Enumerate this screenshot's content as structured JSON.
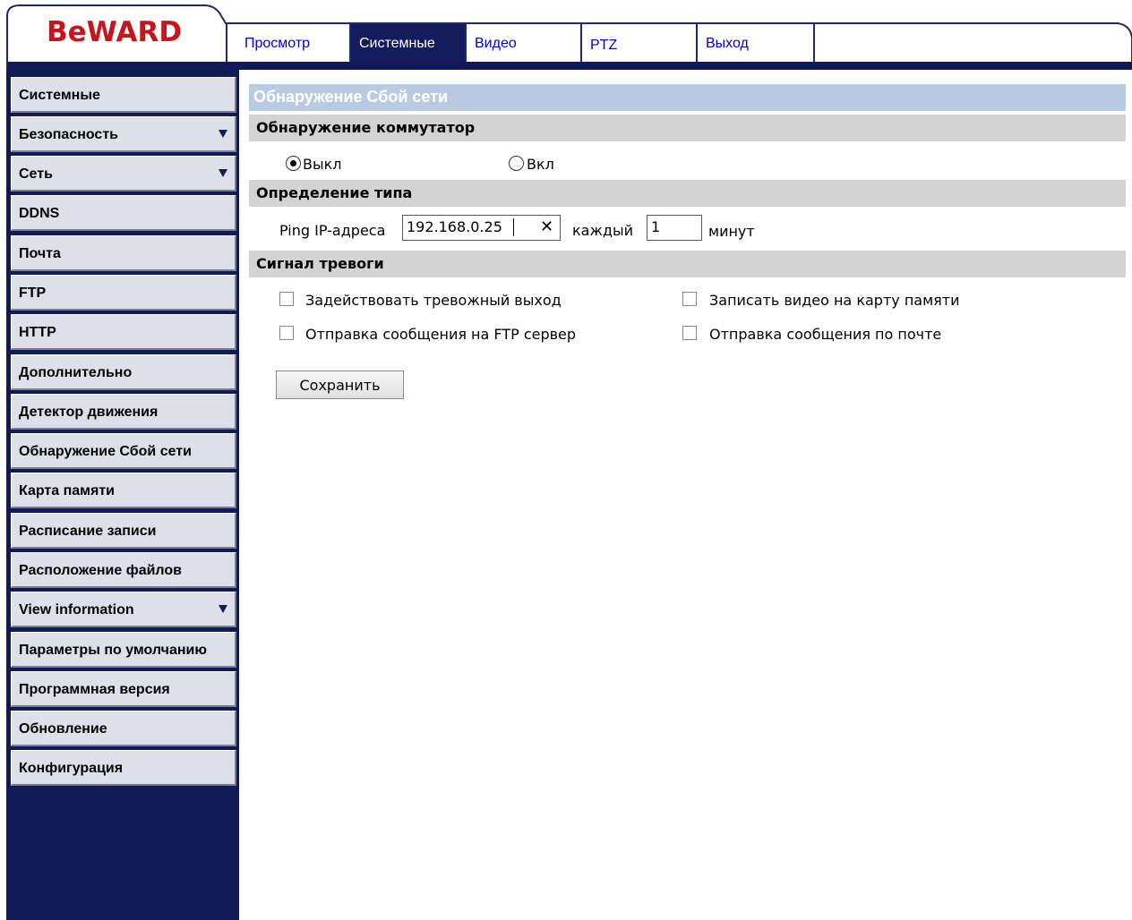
{
  "header": {
    "logo_text": "BeWARD",
    "tabs": [
      {
        "label": "Просмотр"
      },
      {
        "label": "Системные"
      },
      {
        "label": "Видео"
      },
      {
        "label": "PTZ"
      },
      {
        "label": "Выход"
      }
    ],
    "active_tab": "Системные"
  },
  "sidebar": {
    "items": [
      {
        "label": "Системные"
      },
      {
        "label": "Безопасность"
      },
      {
        "label": "Сеть"
      },
      {
        "label": "DDNS"
      },
      {
        "label": "Почта"
      },
      {
        "label": "FTP"
      },
      {
        "label": "HTTP"
      },
      {
        "label": "Дополнительно"
      },
      {
        "label": "Детектор движения"
      },
      {
        "label": "Обнаружение Сбой сети"
      },
      {
        "label": "Карта памяти"
      },
      {
        "label": "Расписание записи"
      },
      {
        "label": "Расположение файлов"
      },
      {
        "label": "View information"
      },
      {
        "label": "Параметры по умолчанию"
      },
      {
        "label": "Программная версия"
      },
      {
        "label": "Обновление"
      },
      {
        "label": "Конфигурация"
      }
    ],
    "expandable": [
      "Безопасность",
      "Сеть",
      "View information"
    ]
  },
  "main": {
    "title": "Обнаружение Сбой сети",
    "switch_section": {
      "title": "Обнаружение коммутатор",
      "off_label": "Выкл",
      "on_label": "Вкл",
      "selected": "Выкл"
    },
    "type_section": {
      "title": "Определение типа",
      "ping_label": "Ping IP-адреса",
      "ip_value": "192.168.0.25",
      "every_label": "каждый",
      "interval_value": "1",
      "unit_label": "минут"
    },
    "alarm_section": {
      "title": "Сигнал тревоги",
      "options": [
        {
          "label": "Задействовать тревожный выход",
          "checked": false
        },
        {
          "label": "Записать видео на карту памяти",
          "checked": false
        },
        {
          "label": "Отправка сообщения на FTP сервер",
          "checked": false
        },
        {
          "label": "Отправка сообщения по почте",
          "checked": false
        }
      ]
    },
    "save_label": "Сохранить"
  },
  "colors": {
    "navy": "#0f1a56",
    "logo_red": "#c4161c",
    "title_bar": "#b9cbe3",
    "section_bar": "#d3d3d3",
    "menu_item": "#dde0e8",
    "tab_link": "#0000cc"
  },
  "icons": {
    "clear": "close-icon",
    "expand": "triangle-down-icon"
  }
}
